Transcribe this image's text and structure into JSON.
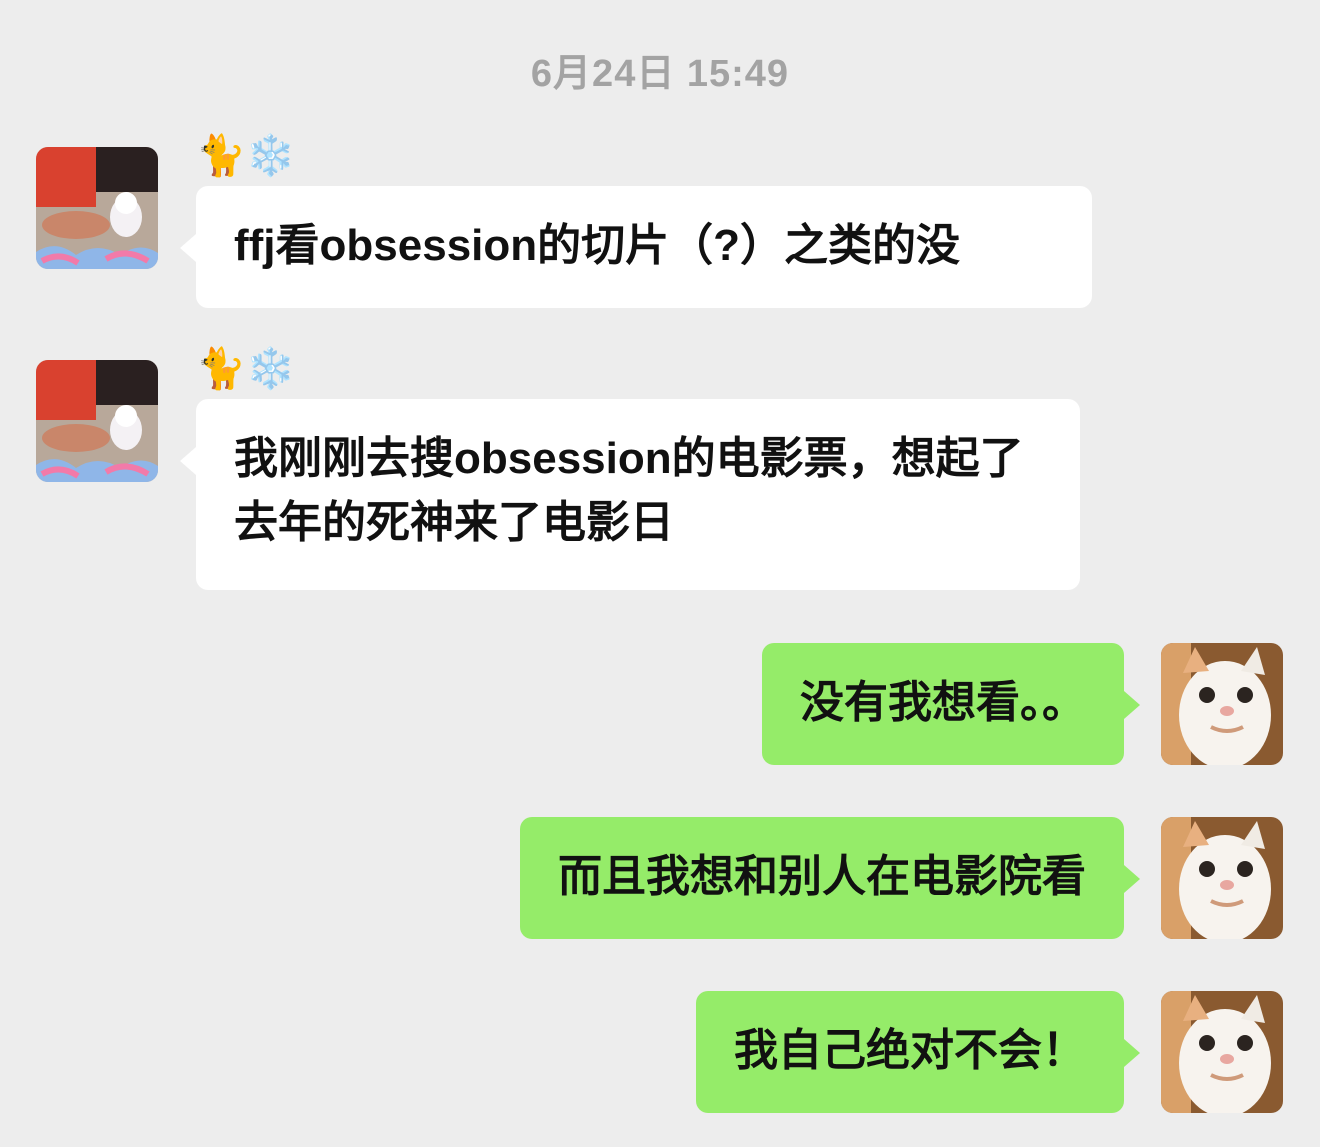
{
  "chat": {
    "timestamp": "6月24日 15:49",
    "messages": [
      {
        "direction": "in",
        "sender": "🐈❄️",
        "avatar": "marie-cat-avatar",
        "text": "ffj看obsession的切片（?）之类的没"
      },
      {
        "direction": "in",
        "sender": "🐈❄️",
        "avatar": "marie-cat-avatar",
        "text": "我刚刚去搜obsession的电影票，想起了去年的死神来了电影日"
      },
      {
        "direction": "out",
        "avatar": "white-cat-avatar",
        "text": "没有我想看。。"
      },
      {
        "direction": "out",
        "avatar": "white-cat-avatar",
        "text": "而且我想和别人在电影院看"
      },
      {
        "direction": "out",
        "avatar": "white-cat-avatar",
        "text": "我自己绝对不会！"
      }
    ]
  },
  "colors": {
    "background": "#ededed",
    "incoming_bubble": "#ffffff",
    "outgoing_bubble": "#95ec69",
    "timestamp_text": "#a3a3a3"
  }
}
